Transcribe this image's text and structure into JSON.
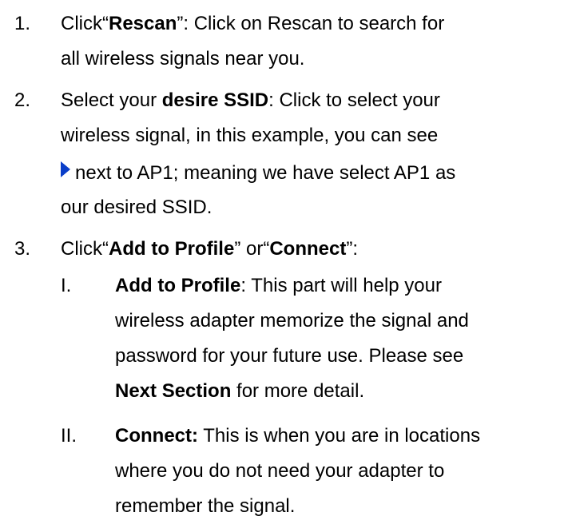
{
  "items": [
    {
      "num": "1.",
      "pre": "Click“",
      "bold": "Rescan",
      "post": "”: Click on Rescan to search for",
      "line2": "all wireless signals near you."
    },
    {
      "num": "2.",
      "pre": "Select your ",
      "bold": "desire SSID",
      "post": ": Click to select your",
      "line2": "wireless signal, in this example, you can see",
      "line3": "next to AP1; meaning we have select AP1 as",
      "line4": "our desired SSID.",
      "icon": "selected-triangle-icon",
      "icon_color": "#0a3ec9"
    },
    {
      "num": "3.",
      "pre": "Click“",
      "bold": "Add to Profile",
      "mid": "” or“",
      "bold2": "Connect",
      "post": "”:"
    }
  ],
  "subitems": [
    {
      "num": "I.",
      "bold": "Add to Profile",
      "post": ": This part will help your",
      "line2": "wireless adapter memorize the signal and",
      "line3": "password for your future use. Please see",
      "line4_bold": "Next Section",
      "line4_post": " for more detail."
    },
    {
      "num": "II.",
      "bold": "Connect:",
      "post": " This is when you are in locations",
      "line2": "where you do not need your adapter to",
      "line3": "remember the signal."
    }
  ]
}
